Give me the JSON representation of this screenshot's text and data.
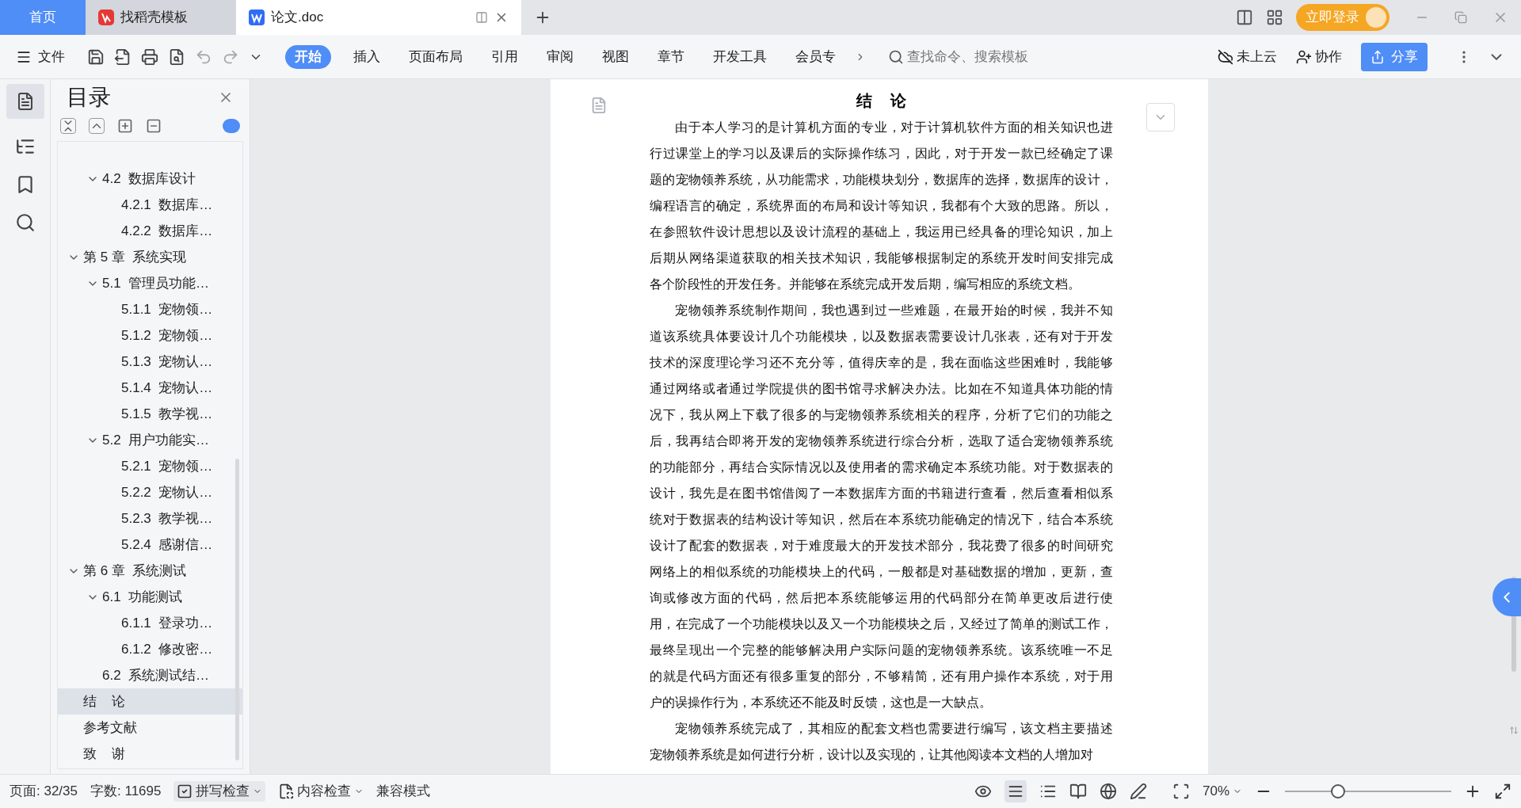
{
  "title_bar": {
    "home": "首页",
    "tabs": [
      {
        "label": "找稻壳模板",
        "selected": false,
        "kind": "template"
      },
      {
        "label": "论文.doc",
        "selected": true,
        "kind": "doc"
      }
    ],
    "login": "立即登录"
  },
  "ribbon": {
    "file_menu": "文件",
    "tabs": [
      {
        "label": "开始",
        "selected": true
      },
      {
        "label": "插入",
        "selected": false
      },
      {
        "label": "页面布局",
        "selected": false
      },
      {
        "label": "引用",
        "selected": false
      },
      {
        "label": "审阅",
        "selected": false
      },
      {
        "label": "视图",
        "selected": false
      },
      {
        "label": "章节",
        "selected": false
      },
      {
        "label": "开发工具",
        "selected": false
      },
      {
        "label": "会员专",
        "selected": false
      }
    ],
    "search": {
      "placeholder": "查找命令、搜索模板"
    },
    "cloud": "未上云",
    "collab": "协作",
    "share": "分享"
  },
  "toc": {
    "title": "目录",
    "items": [
      {
        "children": [
          {
            "label": "4.2  数据库设计",
            "expanded": true,
            "children": [
              {
                "label": "4.2.1  数据库…"
              },
              {
                "label": "4.2.2  数据库…"
              }
            ]
          }
        ]
      },
      {
        "label": "第 5 章  系统实现",
        "expanded": true,
        "children": [
          {
            "label": "5.1  管理员功能…",
            "expanded": true,
            "children": [
              {
                "label": "5.1.1  宠物领…"
              },
              {
                "label": "5.1.2  宠物领…"
              },
              {
                "label": "5.1.3  宠物认…"
              },
              {
                "label": "5.1.4  宠物认…"
              },
              {
                "label": "5.1.5  教学视…"
              }
            ]
          },
          {
            "label": "5.2  用户功能实…",
            "expanded": true,
            "children": [
              {
                "label": "5.2.1  宠物领…"
              },
              {
                "label": "5.2.2  宠物认…"
              },
              {
                "label": "5.2.3  教学视…"
              },
              {
                "label": "5.2.4  感谢信…"
              }
            ]
          }
        ]
      },
      {
        "label": "第 6 章  系统测试",
        "expanded": true,
        "children": [
          {
            "label": "6.1  功能测试",
            "expanded": true,
            "children": [
              {
                "label": "6.1.1  登录功…"
              },
              {
                "label": "6.1.2  修改密…"
              }
            ]
          },
          {
            "label": "6.2  系统测试结…"
          }
        ]
      },
      {
        "label": "结    论",
        "selected": true
      },
      {
        "label": "参考文献",
        "selected": false
      },
      {
        "label": "致    谢",
        "selected": false
      }
    ]
  },
  "document": {
    "title": "结    论",
    "paragraphs": [
      {
        "lines": [
          "由于本人学习的是计算机方面的专业，对于计算机软件方面的相关知识也进",
          "行过课堂上的学习以及课后的实际操作练习，因此，对于开发一款已经确定了课",
          "题的宠物领养系统，从功能需求，功能模块划分，数据库的选择，数据库的设计，",
          "编程语言的确定，系统界面的布局和设计等知识，我都有个大致的思路。所以，",
          "在参照软件设计思想以及设计流程的基础上，我运用已经具备的理论知识，加上",
          "后期从网络渠道获取的相关技术知识，我能够根据制定的系统开发时间安排完成",
          "各个阶段性的开发任务。并能够在系统完成开发后期，编写相应的系统文档。"
        ]
      },
      {
        "lines": [
          "宠物领养系统制作期间，我也遇到过一些难题，在最开始的时候，我并不知",
          "道该系统具体要设计几个功能模块，以及数据表需要设计几张表，还有对于开发",
          "技术的深度理论学习还不充分等，值得庆幸的是，我在面临这些困难时，我能够",
          "通过网络或者通过学院提供的图书馆寻求解决办法。比如在不知道具体功能的情",
          "况下，我从网上下载了很多的与宠物领养系统相关的程序，分析了它们的功能之",
          "后，我再结合即将开发的宠物领养系统进行综合分析，选取了适合宠物领养系统",
          "的功能部分，再结合实际情况以及使用者的需求确定本系统功能。对于数据表的",
          "设计，我先是在图书馆借阅了一本数据库方面的书籍进行查看，然后查看相似系",
          "统对于数据表的结构设计等知识，然后在本系统功能确定的情况下，结合本系统",
          "设计了配套的数据表，对于难度最大的开发技术部分，我花费了很多的时间研究",
          "网络上的相似系统的功能模块上的代码，一般都是对基础数据的增加，更新，查",
          "询或修改方面的代码，然后把本系统能够运用的代码部分在简单更改后进行使",
          "用，在完成了一个功能模块以及又一个功能模块之后，又经过了简单的测试工作，",
          "最终呈现出一个完整的能够解决用户实际问题的宠物领养系统。该系统唯一不足",
          "的就是代码方面还有很多重复的部分，不够精简，还有用户操作本系统，对于用",
          "户的误操作行为，本系统还不能及时反馈，这也是一大缺点。"
        ]
      },
      {
        "lines": [
          "宠物领养系统完成了，其相应的配套文档也需要进行编写，该文档主要描述",
          "宠物领养系统是如何进行分析，设计以及实现的，让其他阅读本文档的人增加对"
        ]
      }
    ]
  },
  "status_bar": {
    "page": "页面: 32/35",
    "words": "字数: 11695",
    "spell_check": "拼写检查",
    "content_check": "内容检查",
    "compat": "兼容模式",
    "zoom": "70%",
    "zoom_slider": {
      "level": 0.32
    }
  }
}
